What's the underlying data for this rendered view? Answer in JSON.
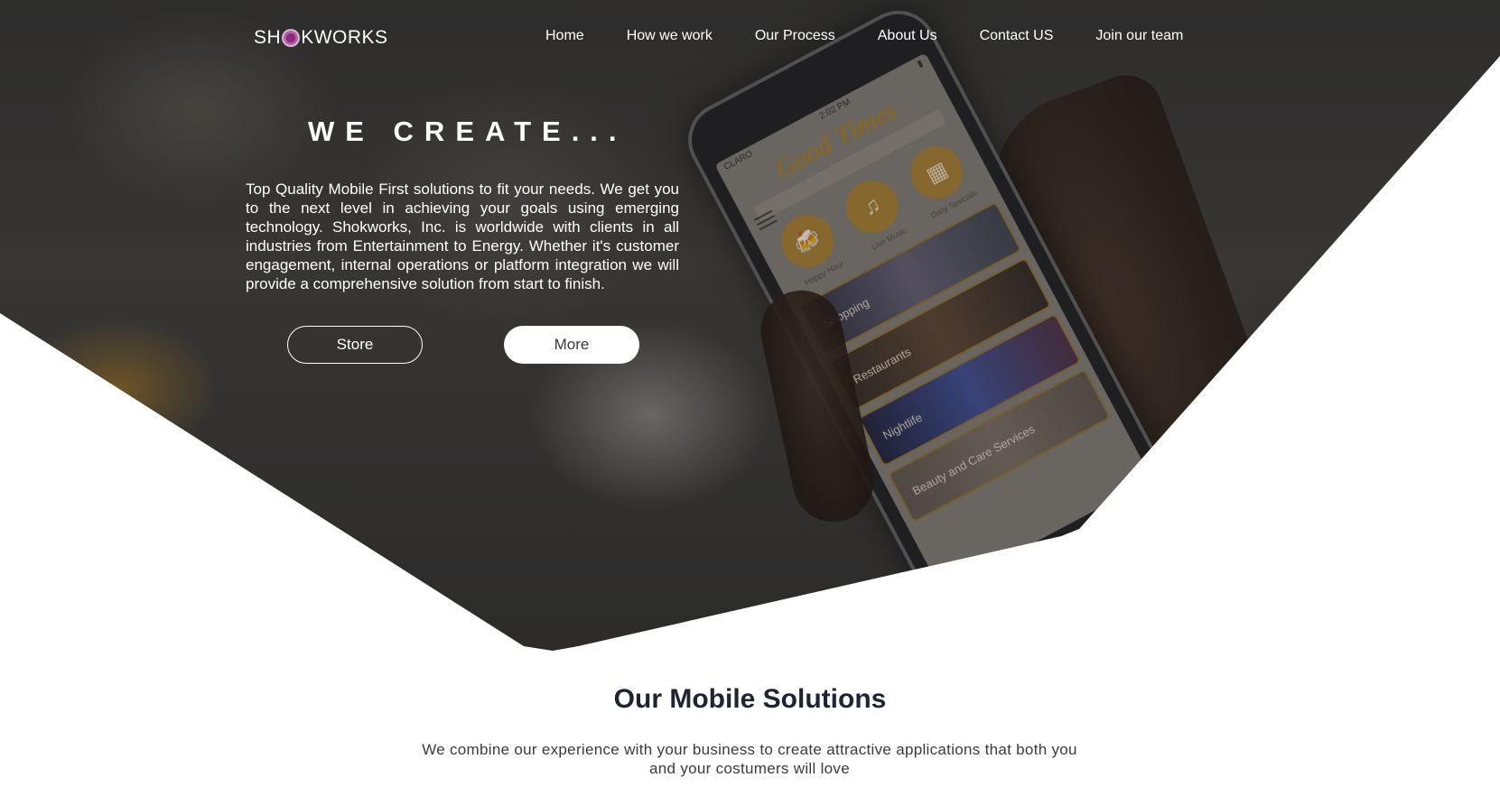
{
  "brand": {
    "logo_prefix": "SH",
    "logo_suffix": "KWORKS",
    "accent_color": "#8a2a7a"
  },
  "nav": {
    "items": [
      {
        "label": "Home"
      },
      {
        "label": "How we work"
      },
      {
        "label": "Our Process"
      },
      {
        "label": "About Us"
      },
      {
        "label": "Contact US"
      },
      {
        "label": "Join our team"
      }
    ]
  },
  "hero": {
    "title": "WE CREATE...",
    "description": "Top Quality Mobile First solutions to fit your needs. We get you to the next level in achieving your goals using emerging technology. Shokworks, Inc. is worldwide with clients in all industries from Entertainment to Energy. Whether it's customer engagement, internal operations or platform integration we will provide a comprehensive solution from start to finish.",
    "store_button": "Store",
    "more_button": "More"
  },
  "phone": {
    "carrier": "CLARO",
    "time": "2:02 PM",
    "app_title": "Good Times",
    "icons": [
      {
        "label": "Happy Hour",
        "icon": "cheers-icon"
      },
      {
        "label": "Live Music",
        "icon": "music-note-icon"
      },
      {
        "label": "Daily Specials",
        "icon": "calendar-icon"
      }
    ],
    "cards": [
      {
        "label": "Shopping"
      },
      {
        "label": "Restaurants"
      },
      {
        "label": "Nightlife"
      },
      {
        "label": "Beauty and Care Services"
      }
    ]
  },
  "solutions": {
    "title": "Our Mobile Solutions",
    "description": "We combine our experience with your business to create attractive applications that both you and your costumers will love"
  }
}
